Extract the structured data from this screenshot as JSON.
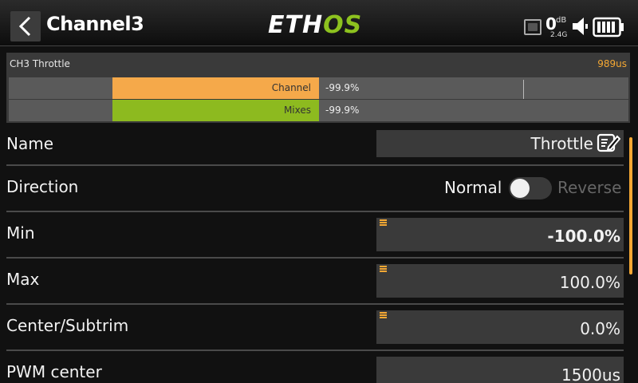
{
  "header": {
    "title": "Channel3",
    "logo_a": "ETH",
    "logo_b": "OS",
    "rssi_value": "0",
    "rssi_unit": "dB",
    "rssi_band": "2.4G",
    "colors": {
      "accent": "#f5a833",
      "brand_green": "#8dc21f"
    }
  },
  "monitor": {
    "channel_name": "CH3  Throttle",
    "pulse": "989us",
    "bars": [
      {
        "label": "Channel",
        "value": "-99.9%",
        "color": "#f5a94a"
      },
      {
        "label": "Mixes",
        "value": "-99.9%",
        "color": "#8dba1f"
      }
    ]
  },
  "rows": {
    "name": {
      "label": "Name",
      "value": "Throttle"
    },
    "direction": {
      "label": "Direction",
      "normal": "Normal",
      "reverse": "Reverse",
      "selected": "Normal"
    },
    "min": {
      "label": "Min",
      "value": "-100.0%"
    },
    "max": {
      "label": "Max",
      "value": "100.0%"
    },
    "center": {
      "label": "Center/Subtrim",
      "value": "0.0%"
    },
    "pwm": {
      "label": "PWM center",
      "value": "1500us"
    }
  },
  "icons": [
    "back-icon",
    "record-icon",
    "speaker-icon",
    "battery-icon",
    "edit-icon",
    "menu-icon"
  ]
}
